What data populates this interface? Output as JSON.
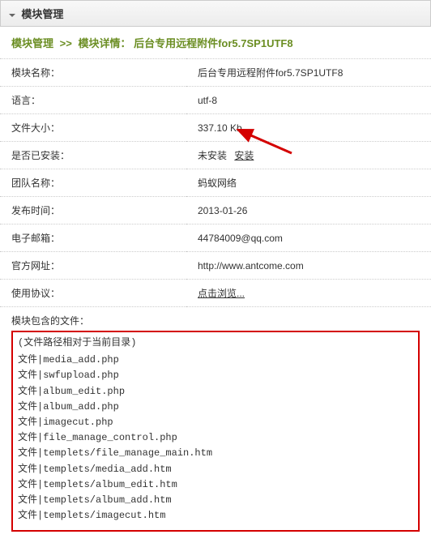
{
  "header": {
    "title": "模块管理"
  },
  "breadcrumb": {
    "root": "模块管理",
    "sep": ">>",
    "prefix": "模块详情：",
    "current": "后台专用远程附件for5.7SP1UTF8"
  },
  "rows": {
    "name_label": "模块名称：",
    "name_value": "后台专用远程附件for5.7SP1UTF8",
    "lang_label": "语言：",
    "lang_value": "utf-8",
    "size_label": "文件大小：",
    "size_value": "337.10 Kb",
    "installed_label": "是否已安装：",
    "installed_value": "未安装",
    "install_action": "安装",
    "team_label": "团队名称：",
    "team_value": "蚂蚁网络",
    "pub_label": "发布时间：",
    "pub_value": "2013-01-26",
    "email_label": "电子邮箱：",
    "email_value": "44784009@qq.com",
    "site_label": "官方网址：",
    "site_value": "http://www.antcome.com",
    "agree_label": "使用协议：",
    "agree_value": "点击浏览..."
  },
  "files": {
    "title": "模块包含的文件：",
    "note": "(文件路径相对于当前目录)",
    "items": [
      "文件|media_add.php",
      "文件|swfupload.php",
      "文件|album_edit.php",
      "文件|album_add.php",
      "文件|imagecut.php",
      "文件|file_manage_control.php",
      "文件|templets/file_manage_main.htm",
      "文件|templets/media_add.htm",
      "文件|templets/album_edit.htm",
      "文件|templets/album_add.htm",
      "文件|templets/imagecut.htm"
    ]
  }
}
